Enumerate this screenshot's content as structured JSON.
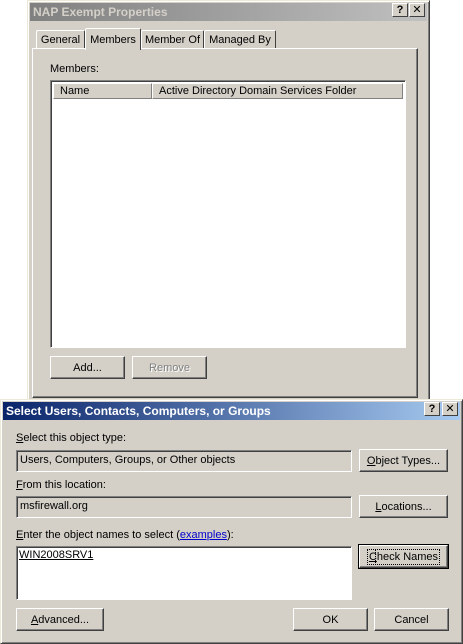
{
  "back_window": {
    "title": "NAP Exempt Properties",
    "help_btn": "?",
    "close_btn": "✕",
    "tabs": [
      "General",
      "Members",
      "Member Of",
      "Managed By"
    ],
    "members_label": "Members:",
    "columns": [
      "Name",
      "Active Directory Domain Services Folder"
    ],
    "add_button": "Add...",
    "remove_button": "Remove"
  },
  "dialog": {
    "title": "Select Users, Contacts, Computers, or Groups",
    "help_btn": "?",
    "close_btn": "✕",
    "object_type_label_acc": "S",
    "object_type_label_rest": "elect this object type:",
    "object_type_value": "Users, Computers, Groups, or Other objects",
    "object_types_button_acc": "O",
    "object_types_button_rest": "bject Types...",
    "location_label_acc": "F",
    "location_label_rest": "rom this location:",
    "location_value": "msfirewall.org",
    "locations_button_acc": "L",
    "locations_button_rest": "ocations...",
    "names_label_acc": "E",
    "names_label_pre": "nter the object names to select (",
    "names_label_link": "examples",
    "names_label_post": "):",
    "names_value": "WIN2008SRV1",
    "check_names_button_acc": "C",
    "check_names_button_rest": "heck Names",
    "advanced_button_acc": "A",
    "advanced_button_rest": "dvanced...",
    "ok_button": "OK",
    "cancel_button": "Cancel"
  }
}
